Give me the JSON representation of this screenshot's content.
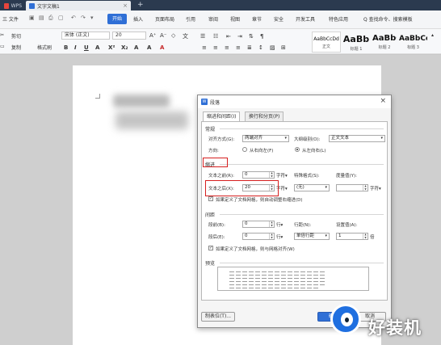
{
  "titlebar": {
    "app_tab": "WPS",
    "doc_tab": "文字文稿1",
    "new_tab": "+"
  },
  "menubar": {
    "file": "三 文件",
    "start": "开始",
    "items": [
      "插入",
      "页面布局",
      "引用",
      "审阅",
      "视图",
      "章节",
      "安全",
      "开发工具",
      "特色应用"
    ],
    "search": "Q 查找命令、搜索模板"
  },
  "toolbar": {
    "paste": "粘贴",
    "cut": "剪切",
    "copy": "复制",
    "format_painter": "格式刷",
    "font_name": "宋体 (正文)",
    "font_size": "20",
    "styles": [
      {
        "preview": "AaBbCcDd",
        "label": "正文"
      },
      {
        "preview": "AaBb",
        "label": "标题 1"
      },
      {
        "preview": "AaBbC",
        "label": "标题 2"
      },
      {
        "preview": "AaBbCc",
        "label": "标题 3"
      }
    ]
  },
  "dialog": {
    "title": "段落",
    "close": "×",
    "tabs": [
      "缩进和间距(I)",
      "换行和分页(P)"
    ],
    "general": {
      "section": "常规",
      "align_label": "对齐方式(G):",
      "align_value": "两端对齐",
      "outline_label": "大纲级别(O):",
      "outline_value": "正文文本",
      "direction_label": "方向:",
      "rtl": "从右向左(F)",
      "ltr": "从左向右(L)"
    },
    "indent": {
      "section": "缩进",
      "before_label": "文本之前(R):",
      "before_value": "0",
      "after_label": "文本之后(X):",
      "after_value": "20",
      "unit": "字符▾",
      "special_label": "特殊格式(S):",
      "special_value": "(无)",
      "measure_label": "度量值(Y):",
      "measure_unit": "字符▾",
      "grid_check": "如果定义了文档网格，则自动调整右缩进(D)"
    },
    "spacing": {
      "section": "间距",
      "before_label": "段前(B):",
      "before_value": "0",
      "after_label": "段后(E):",
      "after_value": "0",
      "unit": "行▾",
      "line_label": "行距(N):",
      "line_value": "单倍行距",
      "setting_label": "设置值(A):",
      "setting_value": "1",
      "setting_unit": "倍",
      "grid_check": "如果定义了文档网格，则与网格对齐(W)"
    },
    "preview_section": "预览",
    "tabs_button": "制表位(T)...",
    "ok_button": "确定",
    "cancel_button": "取消"
  },
  "watermark": {
    "text": "好装机"
  }
}
